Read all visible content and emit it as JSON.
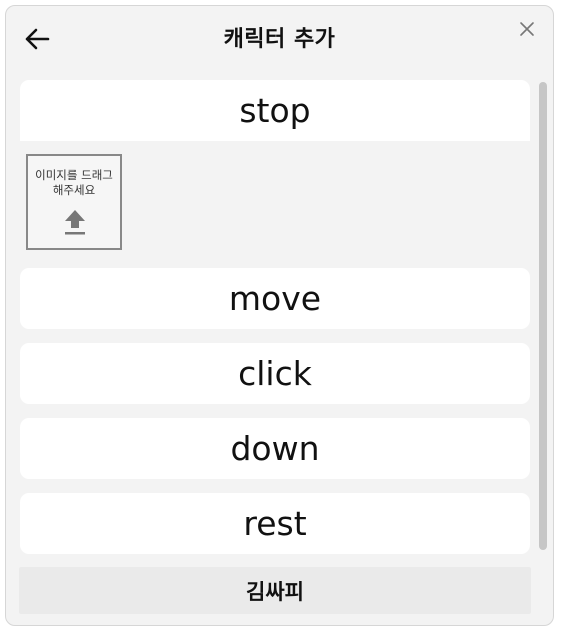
{
  "dialog": {
    "title": "캐릭터 추가",
    "back_icon": "arrow-left-icon",
    "close_icon": "close-icon"
  },
  "states": {
    "first": "stop",
    "dropzone_line1": "이미지를 드래그",
    "dropzone_line2": "해주세요",
    "upload_icon": "upload-icon",
    "items": [
      {
        "label": "move"
      },
      {
        "label": "click"
      },
      {
        "label": "down"
      },
      {
        "label": "rest"
      }
    ]
  },
  "footer": {
    "name": "김싸피"
  }
}
